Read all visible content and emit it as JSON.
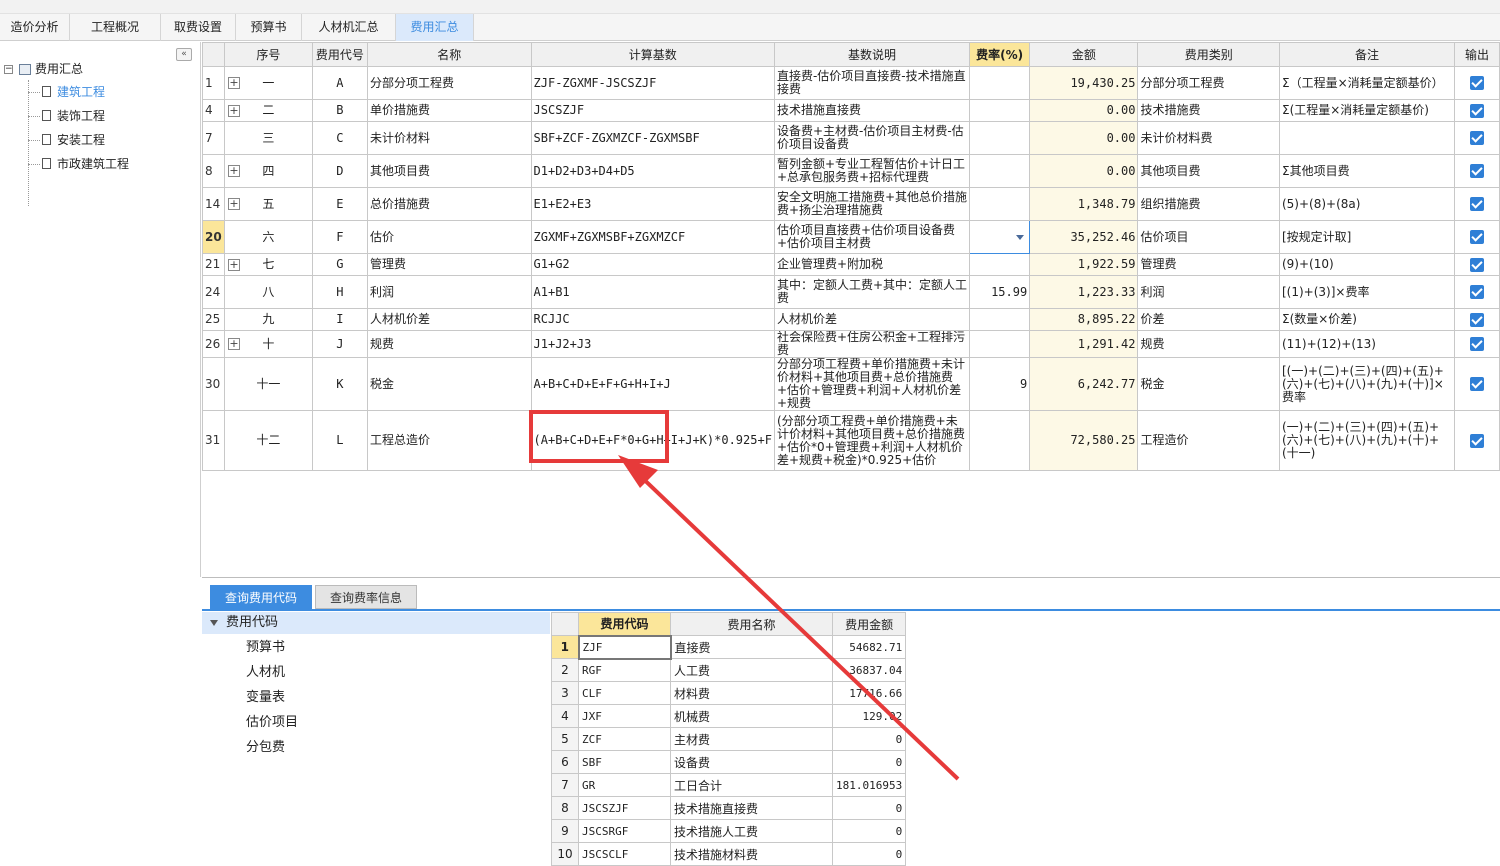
{
  "tabs": [
    "造价分析",
    "工程概况",
    "取费设置",
    "预算书",
    "人材机汇总",
    "费用汇总"
  ],
  "active_tab": 5,
  "left_tree": {
    "collapse_icon": "«",
    "root": "费用汇总",
    "items": [
      "建筑工程",
      "装饰工程",
      "安装工程",
      "市政建筑工程"
    ]
  },
  "grid": {
    "headers": [
      "",
      "序号",
      "费用代号",
      "名称",
      "计算基数",
      "基数说明",
      "费率(%)",
      "金额",
      "费用类别",
      "备注",
      "输出"
    ],
    "rows": [
      {
        "idx": "1",
        "expand": true,
        "seq": "一",
        "code": "A",
        "name": "分部分项工程费",
        "base": "ZJF-ZGXMF-JSCSZJF",
        "desc": "直接费-估价项目直接费-技术措施直接费",
        "rate": "",
        "amount": "19,430.25",
        "category": "分部分项工程费",
        "remark": "Σ（工程量×消耗量定额基价）"
      },
      {
        "idx": "4",
        "expand": true,
        "seq": "二",
        "code": "B",
        "name": "单价措施费",
        "base": "JSCSZJF",
        "desc": "技术措施直接费",
        "rate": "",
        "amount": "0.00",
        "category": "技术措施费",
        "remark": "Σ(工程量×消耗量定额基价)"
      },
      {
        "idx": "7",
        "expand": false,
        "seq": "三",
        "code": "C",
        "name": "未计价材料",
        "base": "SBF+ZCF-ZGXMZCF-ZGXMSBF",
        "desc": "设备费+主材费-估价项目主材费-估价项目设备费",
        "rate": "",
        "amount": "0.00",
        "category": "未计价材料费",
        "remark": ""
      },
      {
        "idx": "8",
        "expand": true,
        "seq": "四",
        "code": "D",
        "name": "其他项目费",
        "base": "D1+D2+D3+D4+D5",
        "desc": "暂列金额+专业工程暂估价+计日工+总承包服务费+招标代理费",
        "rate": "",
        "amount": "0.00",
        "category": "其他项目费",
        "remark": "Σ其他项目费"
      },
      {
        "idx": "14",
        "expand": true,
        "seq": "五",
        "code": "E",
        "name": "总价措施费",
        "base": "E1+E2+E3",
        "desc": "安全文明施工措施费+其他总价措施费+扬尘治理措施费",
        "rate": "",
        "amount": "1,348.79",
        "category": "组织措施费",
        "remark": "(5)+(8)+(8a)"
      },
      {
        "idx": "20",
        "expand": false,
        "seq": "六",
        "code": "F",
        "name": "估价",
        "base": "ZGXMF+ZGXMSBF+ZGXMZCF",
        "desc": "估价项目直接费+估价项目设备费+估价项目主材费",
        "rate": "",
        "amount": "35,252.46",
        "category": "估价项目",
        "remark": "[按规定计取]"
      },
      {
        "idx": "21",
        "expand": true,
        "seq": "七",
        "code": "G",
        "name": "管理费",
        "base": "G1+G2",
        "desc": "企业管理费+附加税",
        "rate": "",
        "amount": "1,922.59",
        "category": "管理费",
        "remark": "(9)+(10)"
      },
      {
        "idx": "24",
        "expand": false,
        "seq": "八",
        "code": "H",
        "name": "利润",
        "base": "A1+B1",
        "desc": "其中：定额人工费+其中：定额人工费",
        "rate": "15.99",
        "amount": "1,223.33",
        "category": "利润",
        "remark": "[(1)+(3)]×费率"
      },
      {
        "idx": "25",
        "expand": false,
        "seq": "九",
        "code": "I",
        "name": "人材机价差",
        "base": "RCJJC",
        "desc": "人材机价差",
        "rate": "",
        "amount": "8,895.22",
        "category": "价差",
        "remark": "Σ(数量×价差)"
      },
      {
        "idx": "26",
        "expand": true,
        "seq": "十",
        "code": "J",
        "name": "规费",
        "base": "J1+J2+J3",
        "desc": "社会保险费+住房公积金+工程排污费",
        "rate": "",
        "amount": "1,291.42",
        "category": "规费",
        "remark": "(11)+(12)+(13)"
      },
      {
        "idx": "30",
        "expand": false,
        "seq": "十一",
        "code": "K",
        "name": "税金",
        "base": "A+B+C+D+E+F+G+H+I+J",
        "desc": "分部分项工程费+单价措施费+未计价材料+其他项目费+总价措施费+估价+管理费+利润+人材机价差+规费",
        "rate": "9",
        "amount": "6,242.77",
        "category": "税金",
        "remark": "[(一)+(二)+(三)+(四)+(五)+(六)+(七)+(八)+(九)+(十)]×费率"
      },
      {
        "idx": "31",
        "expand": false,
        "seq": "十二",
        "code": "L",
        "name": "工程总造价",
        "base": "(A+B+C+D+E+F*0+G+H+I+J+K)*0.925+F",
        "desc": "(分部分项工程费+单价措施费+未计价材料+其他项目费+总价措施费+估价*0+管理费+利润+人材机价差+规费+税金)*0.925+估价",
        "rate": "",
        "amount": "72,580.25",
        "category": "工程造价",
        "remark": "(一)+(二)+(三)+(四)+(五)+(六)+(七)+(八)+(九)+(十)+(十一)"
      }
    ],
    "selected_row": 5
  },
  "bottom": {
    "tabs": [
      "查询费用代码",
      "查询费率信息"
    ],
    "tree_root": "费用代码",
    "tree_items": [
      "预算书",
      "人材机",
      "变量表",
      "估价项目",
      "分包费"
    ],
    "code_headers": [
      "",
      "费用代码",
      "费用名称",
      "费用金额"
    ],
    "codes": [
      {
        "n": "1",
        "code": "ZJF",
        "name": "直接费",
        "value": "54682.71"
      },
      {
        "n": "2",
        "code": "RGF",
        "name": "人工费",
        "value": "36837.04"
      },
      {
        "n": "3",
        "code": "CLF",
        "name": "材料费",
        "value": "17716.66"
      },
      {
        "n": "4",
        "code": "JXF",
        "name": "机械费",
        "value": "129.02"
      },
      {
        "n": "5",
        "code": "ZCF",
        "name": "主材费",
        "value": "0"
      },
      {
        "n": "6",
        "code": "SBF",
        "name": "设备费",
        "value": "0"
      },
      {
        "n": "7",
        "code": "GR",
        "name": "工日合计",
        "value": "181.016953"
      },
      {
        "n": "8",
        "code": "JSCSZJF",
        "name": "技术措施直接费",
        "value": "0"
      },
      {
        "n": "9",
        "code": "JSCSRGF",
        "name": "技术措施人工费",
        "value": "0"
      },
      {
        "n": "10",
        "code": "JSCSCLF",
        "name": "技术措施材料费",
        "value": "0"
      }
    ]
  },
  "colors": {
    "accent": "#3d8ce0",
    "highlight": "#fbe69a",
    "annotation": "#e63a3a"
  }
}
